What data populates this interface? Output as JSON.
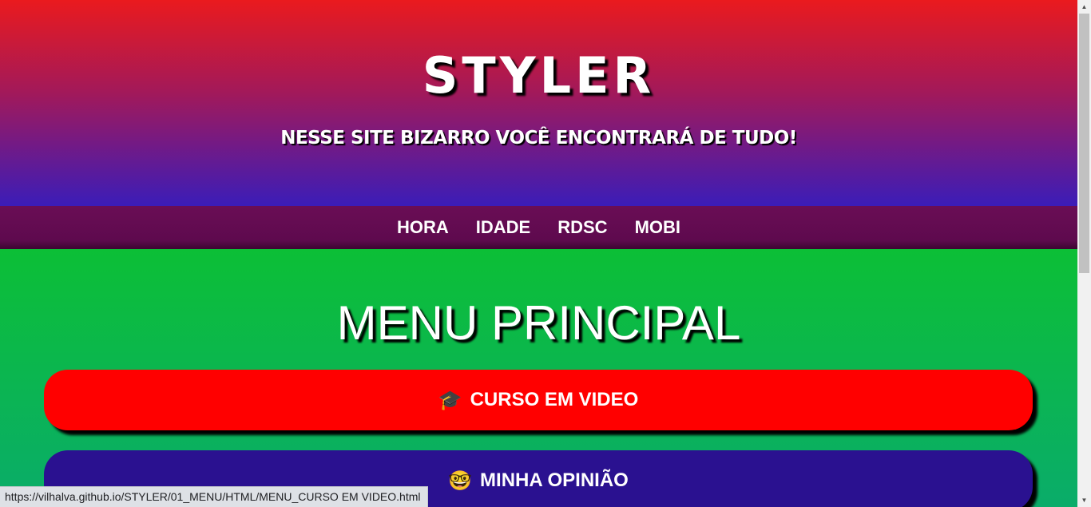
{
  "header": {
    "logo": "STYLER",
    "tagline": "NESSE SITE BIZARRO VOCÊ ENCONTRARÁ DE TUDO!"
  },
  "nav": {
    "items": [
      "HORA",
      "IDADE",
      "RDSC",
      "MOBI"
    ]
  },
  "main": {
    "title": "MENU PRINCIPAL",
    "buttons": [
      {
        "icon": "🎓",
        "label": "CURSO EM VIDEO",
        "color": "#ff0000"
      },
      {
        "icon": "🤓",
        "label": "MINHA OPINIÃO",
        "color": "#2a1190"
      }
    ]
  },
  "status_bar": {
    "url": "https://vilhalva.github.io/STYLER/01_MENU/HTML/MENU_CURSO EM VIDEO.html"
  },
  "colors": {
    "header_top": "#ea1a1e",
    "header_bottom": "#3b1cb8",
    "nav_bg": "#5e0a4e",
    "main_bg": "#0cbf36"
  }
}
